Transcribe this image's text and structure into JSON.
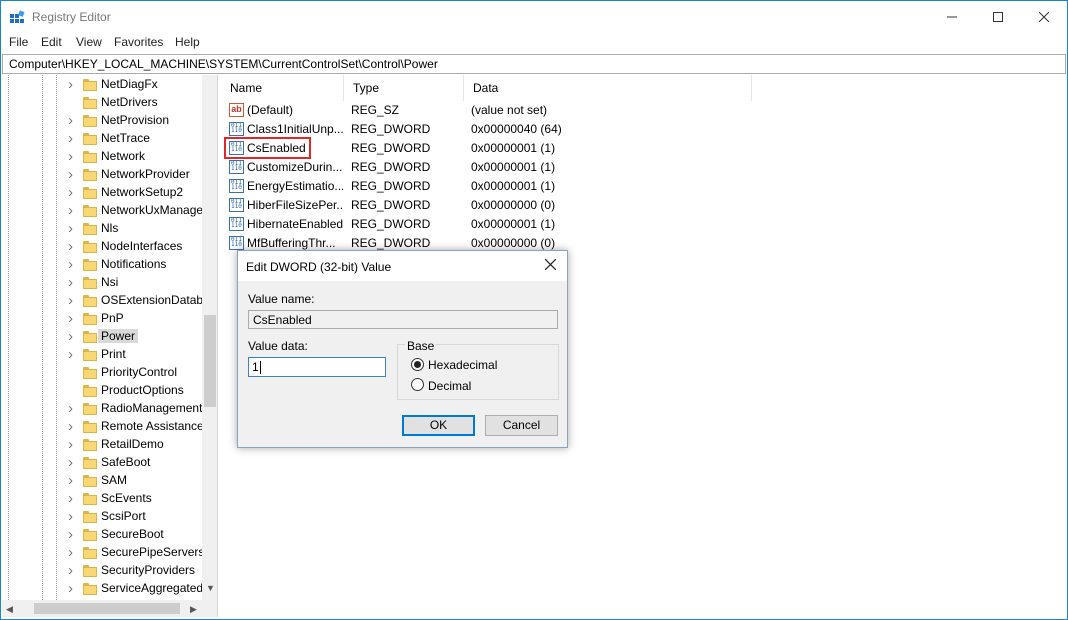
{
  "window": {
    "title": "Registry Editor",
    "controls": {
      "minimize": "—",
      "maximize": "☐",
      "close": "✕"
    }
  },
  "menu": [
    "File",
    "Edit",
    "View",
    "Favorites",
    "Help"
  ],
  "address": "Computer\\HKEY_LOCAL_MACHINE\\SYSTEM\\CurrentControlSet\\Control\\Power",
  "tree": {
    "items": [
      {
        "label": "NetDiagFx",
        "expandable": true
      },
      {
        "label": "NetDrivers",
        "expandable": false
      },
      {
        "label": "NetProvision",
        "expandable": true
      },
      {
        "label": "NetTrace",
        "expandable": true
      },
      {
        "label": "Network",
        "expandable": true
      },
      {
        "label": "NetworkProvider",
        "expandable": true
      },
      {
        "label": "NetworkSetup2",
        "expandable": true
      },
      {
        "label": "NetworkUxManage",
        "expandable": true
      },
      {
        "label": "Nls",
        "expandable": true
      },
      {
        "label": "NodeInterfaces",
        "expandable": true
      },
      {
        "label": "Notifications",
        "expandable": true
      },
      {
        "label": "Nsi",
        "expandable": true
      },
      {
        "label": "OSExtensionDataba",
        "expandable": true
      },
      {
        "label": "PnP",
        "expandable": true
      },
      {
        "label": "Power",
        "expandable": true,
        "selected": true
      },
      {
        "label": "Print",
        "expandable": true
      },
      {
        "label": "PriorityControl",
        "expandable": false
      },
      {
        "label": "ProductOptions",
        "expandable": false
      },
      {
        "label": "RadioManagement",
        "expandable": true
      },
      {
        "label": "Remote Assistance",
        "expandable": true
      },
      {
        "label": "RetailDemo",
        "expandable": true
      },
      {
        "label": "SafeBoot",
        "expandable": true
      },
      {
        "label": "SAM",
        "expandable": true
      },
      {
        "label": "ScEvents",
        "expandable": true
      },
      {
        "label": "ScsiPort",
        "expandable": true
      },
      {
        "label": "SecureBoot",
        "expandable": true
      },
      {
        "label": "SecurePipeServers",
        "expandable": true
      },
      {
        "label": "SecurityProviders",
        "expandable": true
      },
      {
        "label": "ServiceAggregated",
        "expandable": true
      }
    ]
  },
  "list": {
    "columns": [
      "Name",
      "Type",
      "Data"
    ],
    "rows": [
      {
        "name": "(Default)",
        "type": "REG_SZ",
        "data": "(value not set)",
        "icon": "string-value-icon"
      },
      {
        "name": "Class1InitialUnp...",
        "type": "REG_DWORD",
        "data": "0x00000040 (64)",
        "icon": "dword-value-icon"
      },
      {
        "name": "CsEnabled",
        "type": "REG_DWORD",
        "data": "0x00000001 (1)",
        "icon": "dword-value-icon"
      },
      {
        "name": "CustomizeDurin...",
        "type": "REG_DWORD",
        "data": "0x00000001 (1)",
        "icon": "dword-value-icon"
      },
      {
        "name": "EnergyEstimatio...",
        "type": "REG_DWORD",
        "data": "0x00000001 (1)",
        "icon": "dword-value-icon"
      },
      {
        "name": "HiberFileSizePer...",
        "type": "REG_DWORD",
        "data": "0x00000000 (0)",
        "icon": "dword-value-icon"
      },
      {
        "name": "HibernateEnabled",
        "type": "REG_DWORD",
        "data": "0x00000001 (1)",
        "icon": "dword-value-icon"
      },
      {
        "name": "MfBufferingThr...",
        "type": "REG_DWORD",
        "data": "0x00000000 (0)",
        "icon": "dword-value-icon"
      }
    ]
  },
  "dialog": {
    "title": "Edit DWORD (32-bit) Value",
    "value_name_label": "Value name:",
    "value_name": "CsEnabled",
    "value_data_label": "Value data:",
    "value_data": "1",
    "base_label": "Base",
    "base_options": [
      "Hexadecimal",
      "Decimal"
    ],
    "base_selected": "Hexadecimal",
    "ok_label": "OK",
    "cancel_label": "Cancel",
    "close_glyph": "✕"
  },
  "colors": {
    "highlight_box": "#e02626",
    "folder": "#f8d775",
    "accent": "#0078d7"
  }
}
